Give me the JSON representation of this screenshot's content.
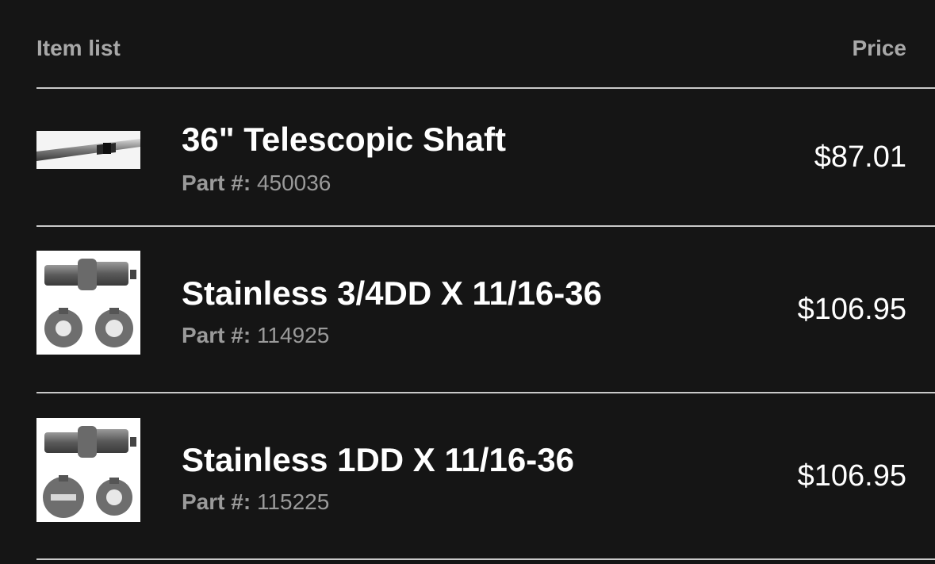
{
  "header": {
    "item_list_label": "Item list",
    "price_label": "Price"
  },
  "items": [
    {
      "title": "36\" Telescopic Shaft",
      "part_label": "Part #:",
      "part_number": "450036",
      "price": "$87.01",
      "image": "telescopic-shaft-image"
    },
    {
      "title": "Stainless 3/4DD X 11/16-36",
      "part_label": "Part #:",
      "part_number": "114925",
      "price": "$106.95",
      "image": "universal-joint-image"
    },
    {
      "title": "Stainless 1DD X 11/16-36",
      "part_label": "Part #:",
      "part_number": "115225",
      "price": "$106.95",
      "image": "universal-joint-image"
    }
  ]
}
